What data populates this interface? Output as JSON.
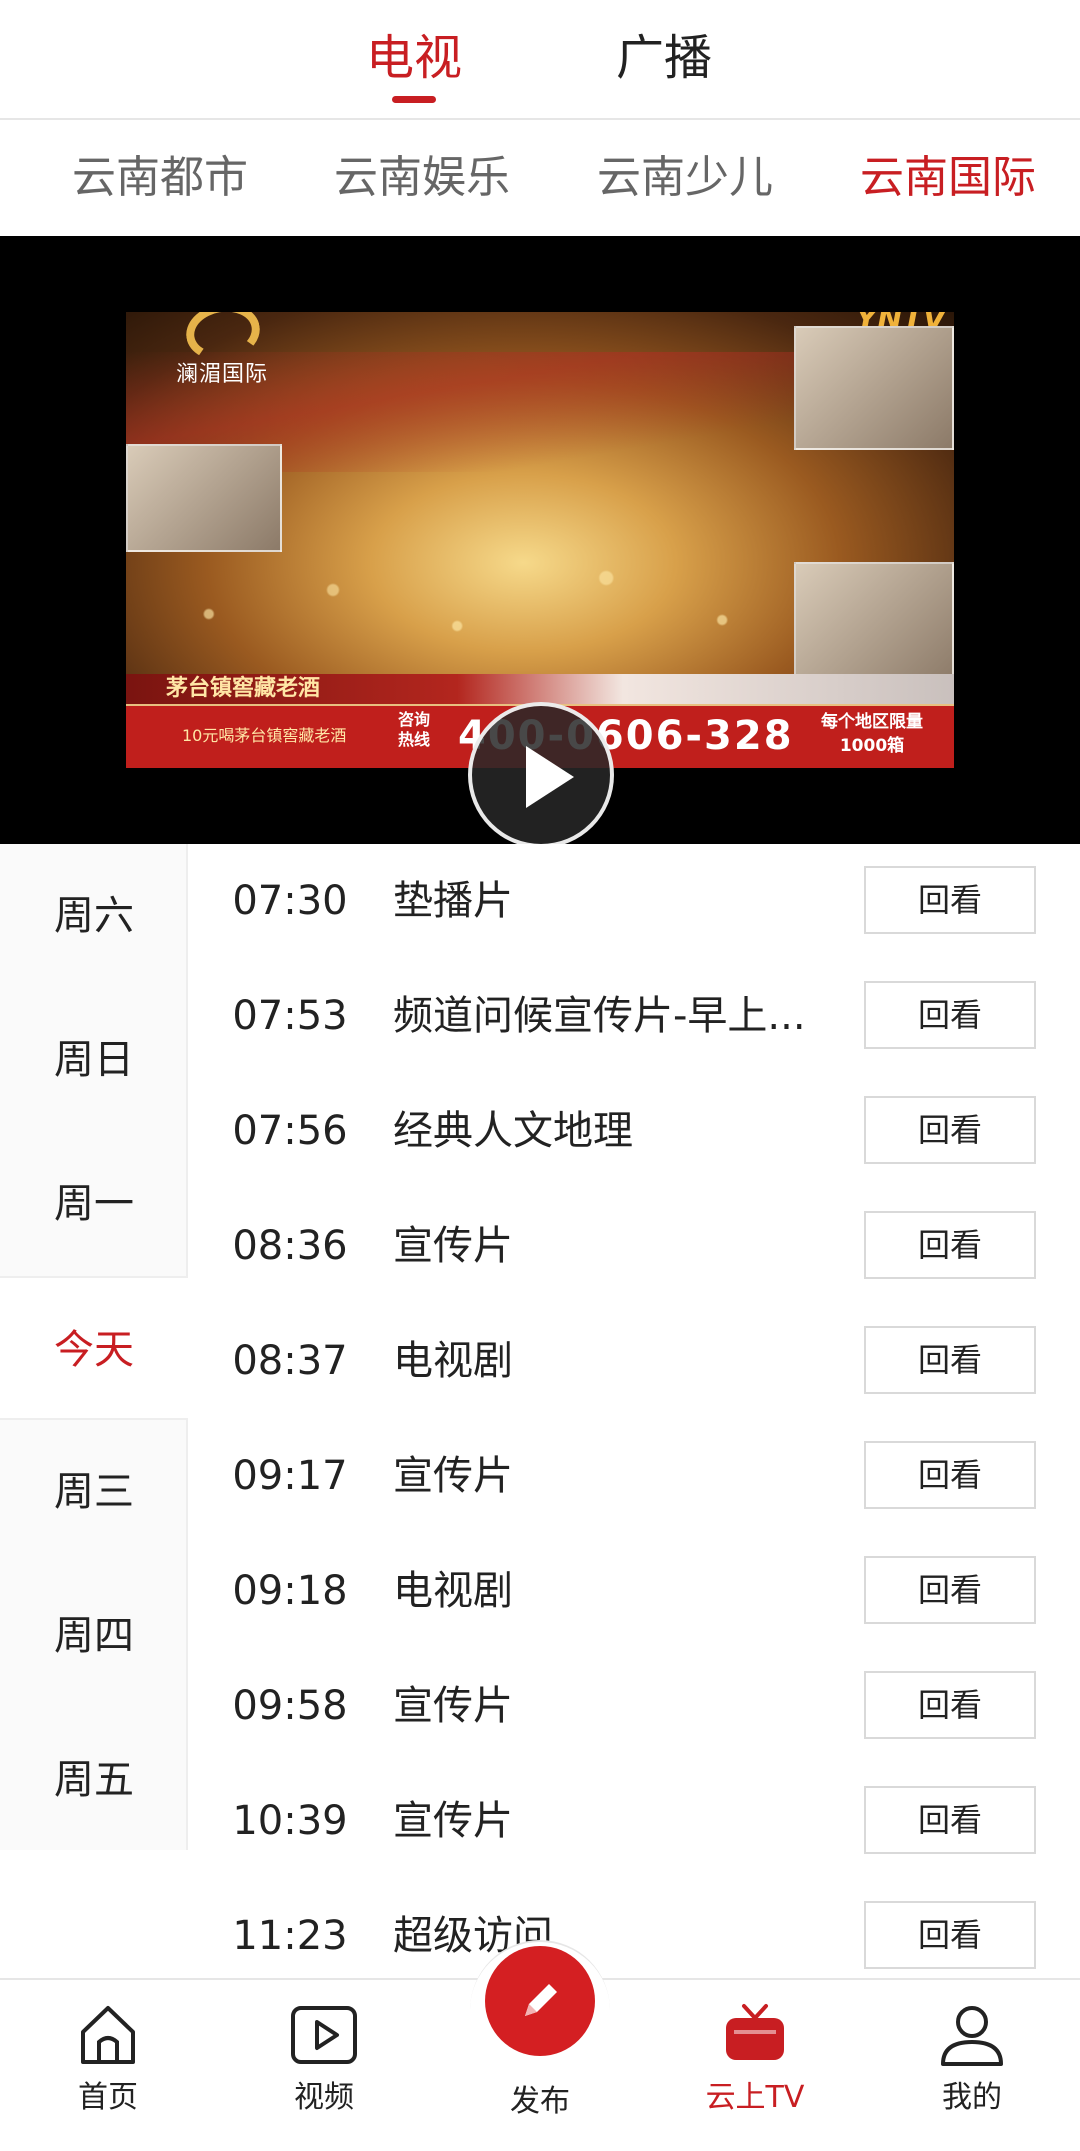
{
  "top_tabs": [
    {
      "label": "电视",
      "active": true
    },
    {
      "label": "广播",
      "active": false
    }
  ],
  "channel_tabs": [
    {
      "label": "云南都市",
      "active": false
    },
    {
      "label": "云南娱乐",
      "active": false
    },
    {
      "label": "云南少儿",
      "active": false
    },
    {
      "label": "云南国际",
      "active": true
    }
  ],
  "video": {
    "channel_logo_text": "澜湄国际",
    "watermark": "YNTV",
    "ad_title": "茅台镇窖藏老酒",
    "ad_subtitle": "10元喝茅台镇窖藏老酒",
    "ad_consult": "咨询热线",
    "ad_phone": "400-0606-328",
    "ad_note": "每个地区限量1000箱"
  },
  "days": [
    {
      "label": "周六",
      "active": false
    },
    {
      "label": "周日",
      "active": false
    },
    {
      "label": "周一",
      "active": false
    },
    {
      "label": "今天",
      "active": true
    },
    {
      "label": "周三",
      "active": false
    },
    {
      "label": "周四",
      "active": false
    },
    {
      "label": "周五",
      "active": false
    }
  ],
  "replay_label": "回看",
  "schedule": [
    {
      "time": "07:30",
      "program": "垫播片"
    },
    {
      "time": "07:53",
      "program": "频道问候宣传片-早上..."
    },
    {
      "time": "07:56",
      "program": "经典人文地理"
    },
    {
      "time": "08:36",
      "program": "宣传片"
    },
    {
      "time": "08:37",
      "program": "电视剧"
    },
    {
      "time": "09:17",
      "program": "宣传片"
    },
    {
      "time": "09:18",
      "program": "电视剧"
    },
    {
      "time": "09:58",
      "program": "宣传片"
    },
    {
      "time": "10:39",
      "program": "宣传片"
    },
    {
      "time": "11:23",
      "program": "超级访问"
    }
  ],
  "bottom_nav": {
    "home": "首页",
    "video": "视频",
    "publish": "发布",
    "tv": "云上TV",
    "mine": "我的"
  },
  "colors": {
    "accent": "#c81e22",
    "publish": "#d41f22",
    "text": "#222222",
    "muted": "#666666"
  }
}
